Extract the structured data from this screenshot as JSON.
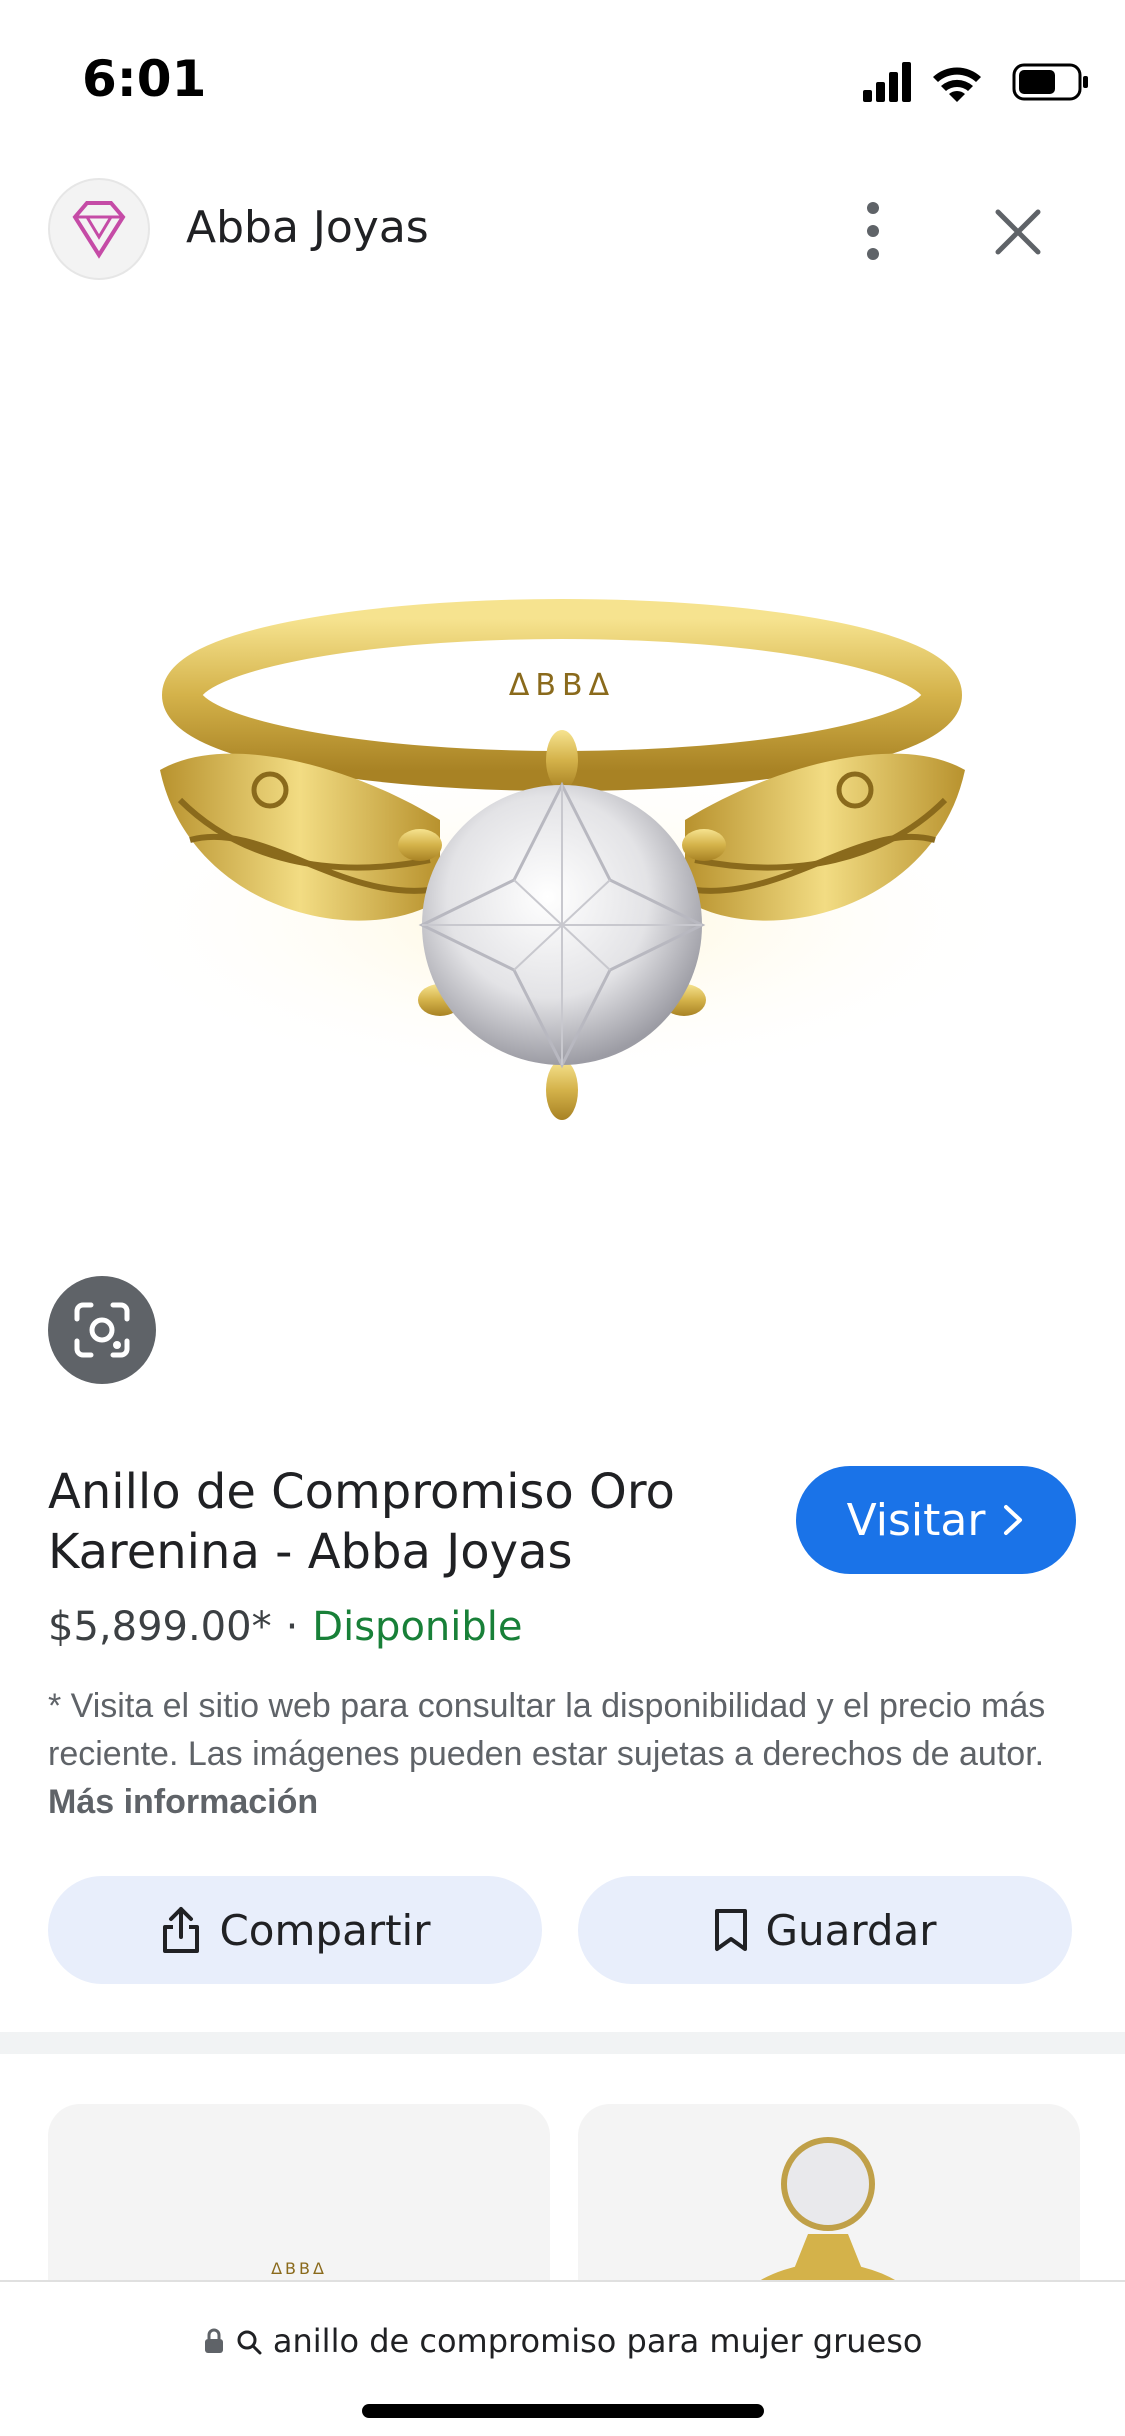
{
  "status_bar": {
    "time": "6:01",
    "icons": [
      "signal-icon",
      "wifi-icon",
      "battery-icon"
    ]
  },
  "header": {
    "site_name": "Abba Joyas",
    "logo_icon": "abba-diamond-logo-icon",
    "menu_icon": "more-vert-icon",
    "close_icon": "close-icon"
  },
  "product": {
    "image_icon": "gold-ring-image",
    "engraving": "ΔBBΔ",
    "lens_icon": "lens-icon",
    "title": "Anillo de Compromiso Oro Karenina - Abba Joyas",
    "visit_label": "Visitar",
    "price": "$5,899.00*",
    "separator": "·",
    "availability": "Disponible",
    "disclaimer": "* Visita el sitio web para consultar la disponibilidad y el precio más reciente. Las imágenes pueden estar sujetas a derechos de autor.",
    "more_info_label": "Más información"
  },
  "actions": {
    "share_label": "Compartir",
    "save_label": "Guardar"
  },
  "related": {
    "card_1_engraving": "ΔBBΔ"
  },
  "bottom_bar": {
    "url_text": "anillo de compromiso para mujer grueso"
  },
  "colors": {
    "accent": "#1a73e8",
    "available": "#188038",
    "chip_bg": "#e8eefb",
    "gold": "#d4b24a"
  }
}
